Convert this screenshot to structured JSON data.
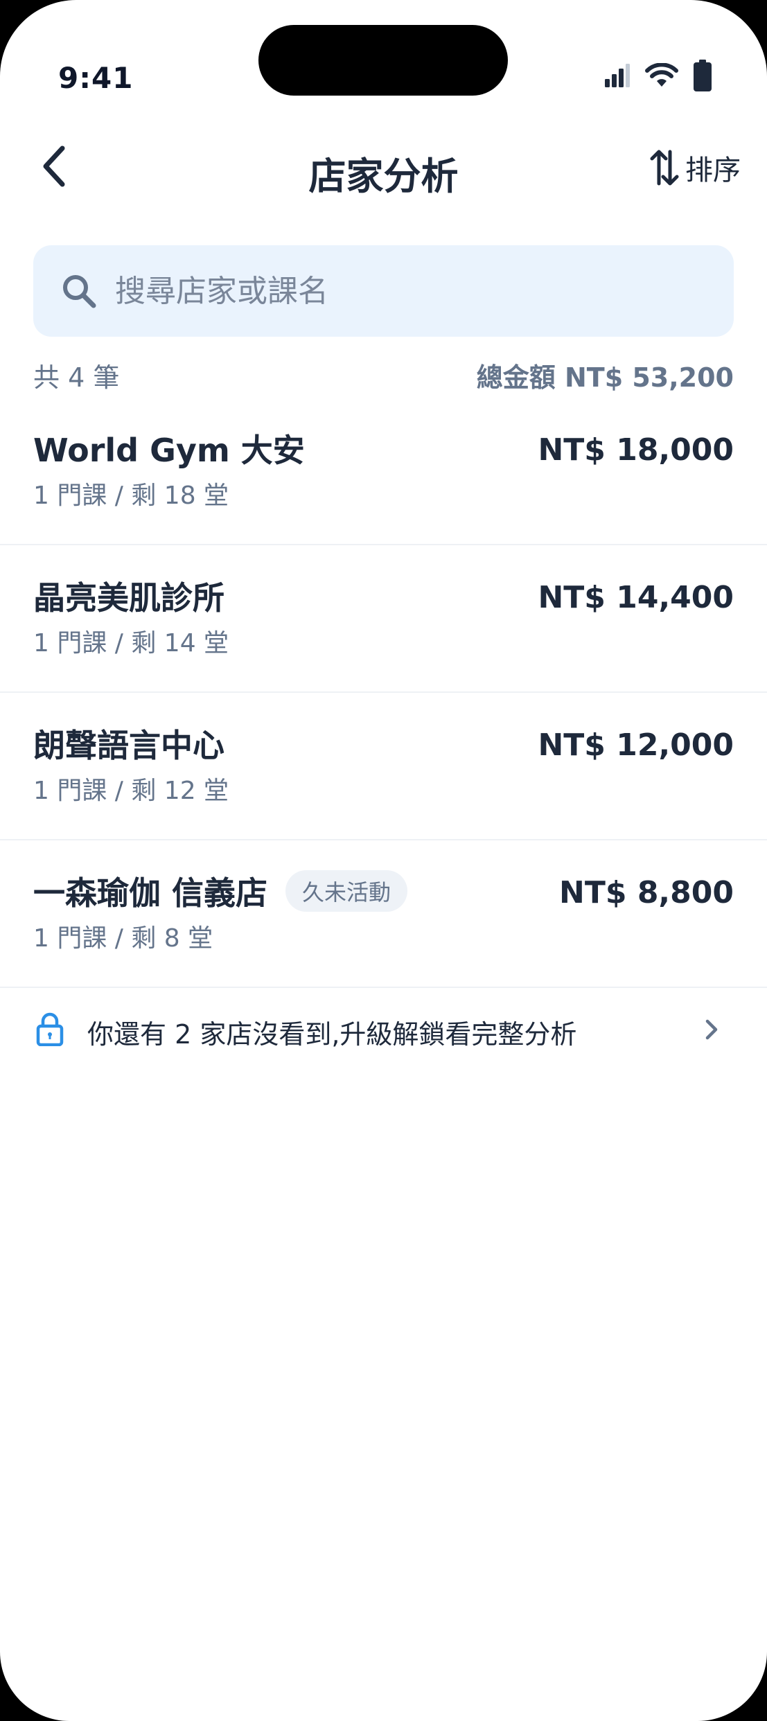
{
  "status_bar": {
    "time": "9:41"
  },
  "nav": {
    "title": "店家分析",
    "sort_label": "排序"
  },
  "search": {
    "placeholder": "搜尋店家或課名",
    "value": ""
  },
  "summary": {
    "count": "共 4 筆",
    "total": "總金額 NT$ 53,200"
  },
  "stores": [
    {
      "name": "World Gym 大安",
      "meta": "1 門課 / 剩 18 堂",
      "amount": "NT$ 18,000",
      "badge": ""
    },
    {
      "name": "晶亮美肌診所",
      "meta": "1 門課 / 剩 14 堂",
      "amount": "NT$ 14,400",
      "badge": ""
    },
    {
      "name": "朗聲語言中心",
      "meta": "1 門課 / 剩 12 堂",
      "amount": "NT$ 12,000",
      "badge": ""
    },
    {
      "name": "一森瑜伽 信義店",
      "meta": "1 門課 / 剩 8 堂",
      "amount": "NT$ 8,800",
      "badge": "久未活動"
    }
  ],
  "upgrade": {
    "text": "你還有 2 家店沒看到,升級解鎖看完整分析"
  },
  "colors": {
    "accent": "#2b8fe6",
    "text": "#1e293b",
    "muted": "#64748b",
    "search_bg": "#eaf3fd"
  }
}
